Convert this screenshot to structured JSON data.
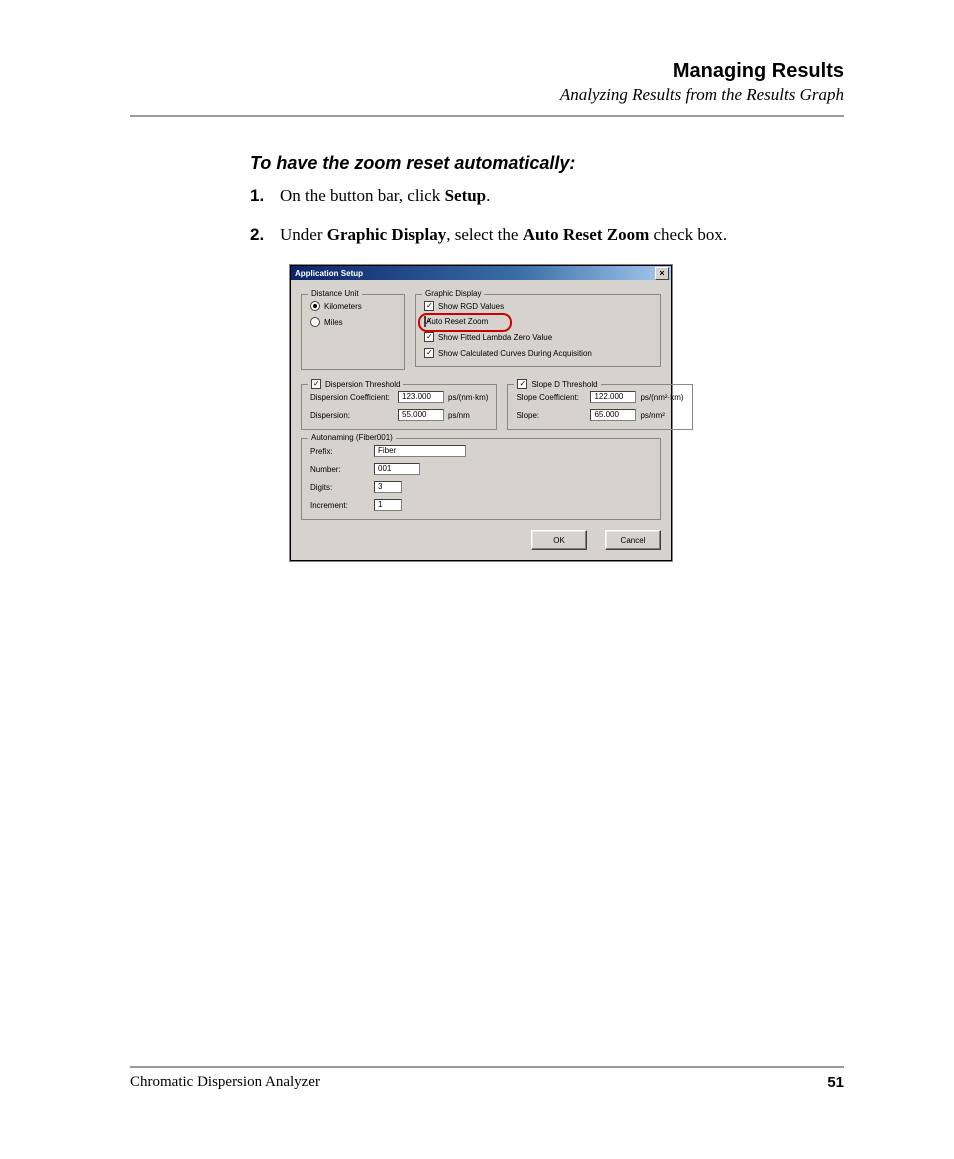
{
  "header": {
    "title": "Managing Results",
    "subtitle": "Analyzing Results from the Results Graph"
  },
  "task": {
    "title": "To have the zoom reset automatically:",
    "steps": [
      {
        "num": "1.",
        "pre": "On the button bar, click ",
        "bold": "Setup",
        "post": "."
      },
      {
        "num": "2.",
        "pre": "Under ",
        "bold": "Graphic Display",
        "mid": ", select the ",
        "bold2": "Auto Reset Zoom",
        "post": " check box."
      }
    ]
  },
  "dialog": {
    "title": "Application Setup",
    "close": "×",
    "distanceUnit": {
      "legend": "Distance Unit",
      "kilometers": "Kilometers",
      "miles": "Miles"
    },
    "graphicDisplay": {
      "legend": "Graphic Display",
      "showRGD": "Show RGD Values",
      "autoReset": "Auto Reset Zoom",
      "showFitted": "Show Fitted Lambda Zero Value",
      "showCalc": "Show Calculated Curves During Acquisition"
    },
    "dispersionThreshold": {
      "legend": "Dispersion Threshold",
      "coefLabel": "Dispersion Coefficient:",
      "coefValue": "123.000",
      "coefUnit": "ps/(nm·km)",
      "dispLabel": "Dispersion:",
      "dispValue": "55.000",
      "dispUnit": "ps/nm"
    },
    "slopeThreshold": {
      "legend": "Slope D Threshold",
      "coefLabel": "Slope Coefficient:",
      "coefValue": "122.000",
      "coefUnit": "ps/(nm²·km)",
      "slopeLabel": "Slope:",
      "slopeValue": "65.000",
      "slopeUnit": "ps/nm²"
    },
    "autonaming": {
      "legend": "Autonaming (Fiber001)",
      "prefixLabel": "Prefix:",
      "prefixValue": "Fiber",
      "numberLabel": "Number:",
      "numberValue": "001",
      "digitsLabel": "Digits:",
      "digitsValue": "3",
      "incLabel": "Increment:",
      "incValue": "1"
    },
    "buttons": {
      "ok": "OK",
      "cancel": "Cancel"
    }
  },
  "footer": {
    "left": "Chromatic Dispersion Analyzer",
    "page": "51"
  }
}
